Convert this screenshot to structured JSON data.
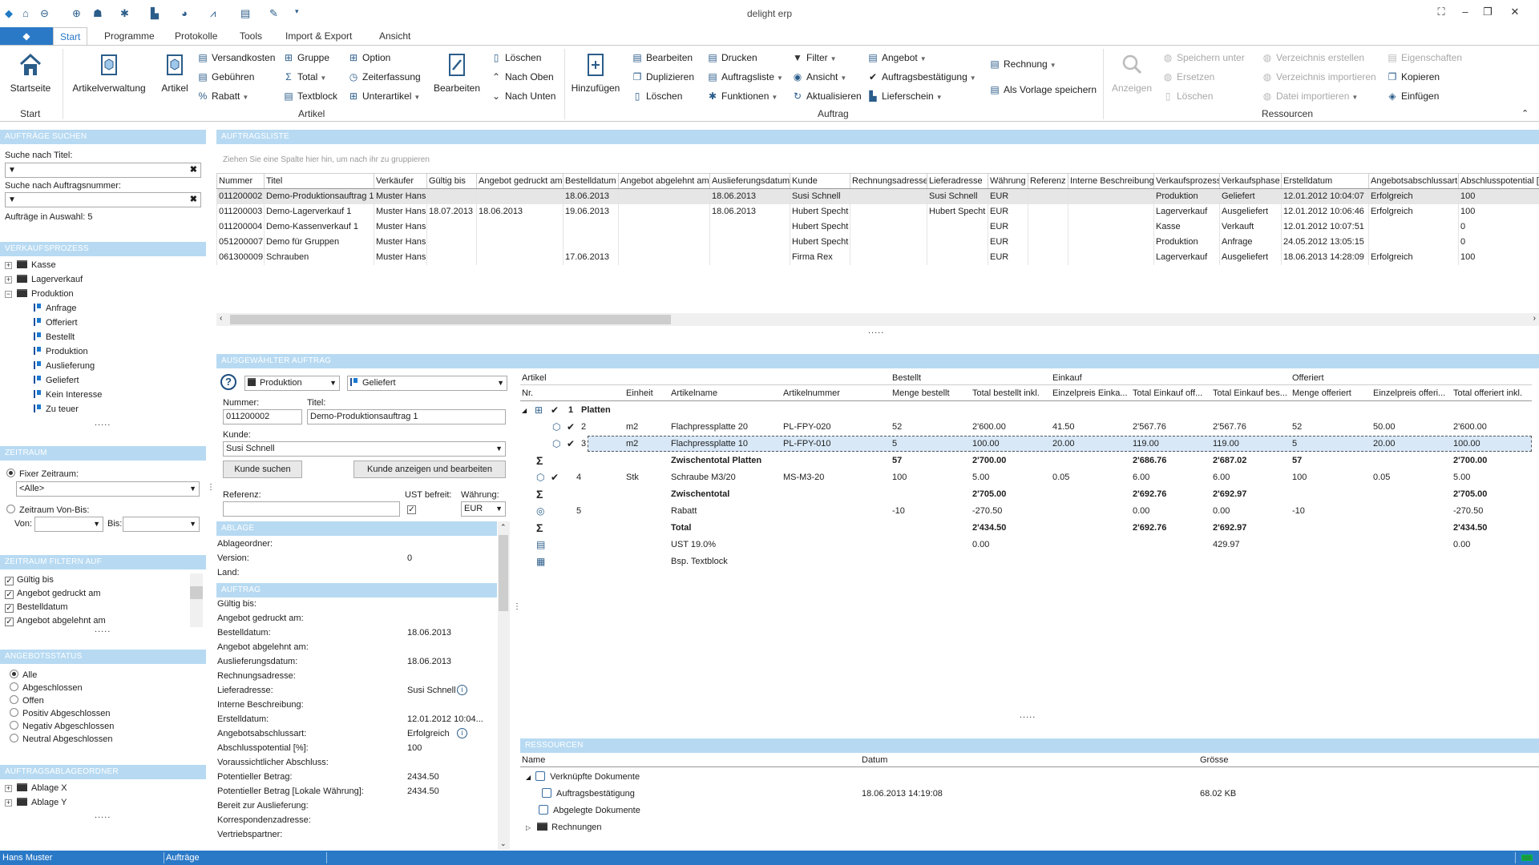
{
  "app": {
    "title": "delight erp"
  },
  "tabs": {
    "file": "◆",
    "items": [
      "Start",
      "Programme",
      "Protokolle",
      "Tools",
      "Import & Export",
      "Ansicht"
    ]
  },
  "ribbon": {
    "startseite": "Startseite",
    "artikelverwaltung": "Artikelverwaltung",
    "artikel": "Artikel",
    "versandkosten": "Versandkosten",
    "gebuehren": "Gebühren",
    "rabatt": "Rabatt",
    "gruppe": "Gruppe",
    "total": "Total",
    "textblock": "Textblock",
    "option": "Option",
    "zeiterfassung": "Zeiterfassung",
    "unterartikel": "Unterartikel",
    "bearbeiten": "Bearbeiten",
    "loeschen": "Löschen",
    "nach_oben": "Nach Oben",
    "nach_unten": "Nach Unten",
    "hinzufuegen": "Hinzufügen",
    "bearbeiten2": "Bearbeiten",
    "duplizieren": "Duplizieren",
    "loeschen2": "Löschen",
    "drucken": "Drucken",
    "auftragsliste": "Auftragsliste",
    "funktionen": "Funktionen",
    "filter": "Filter",
    "ansicht": "Ansicht",
    "aktualisieren": "Aktualisieren",
    "angebot": "Angebot",
    "auftragsbestaetigung": "Auftragsbestätigung",
    "lieferschein": "Lieferschein",
    "rechnung": "Rechnung",
    "als_vorlage": "Als Vorlage speichern",
    "anzeigen": "Anzeigen",
    "speichern_unter": "Speichern unter",
    "ersetzen": "Ersetzen",
    "loeschen3": "Löschen",
    "verz_erstellen": "Verzeichnis erstellen",
    "verz_importieren": "Verzeichnis importieren",
    "datei_importieren": "Datei importieren",
    "eigenschaften": "Eigenschaften",
    "kopieren": "Kopieren",
    "einfuegen": "Einfügen",
    "groups": {
      "start": "Start",
      "artikel": "Artikel",
      "auftrag": "Auftrag",
      "ressourcen": "Ressourcen"
    }
  },
  "left": {
    "search_header": "AUFTRÄGE SUCHEN",
    "title_label": "Suche nach Titel:",
    "number_label": "Suche nach Auftragsnummer:",
    "count_text": "Aufträge in Auswahl:  5",
    "process_header": "VERKAUFSPROZESS",
    "process_items": [
      "Kasse",
      "Lagerverkauf",
      "Produktion"
    ],
    "phases": [
      "Anfrage",
      "Offeriert",
      "Bestellt",
      "Produktion",
      "Auslieferung",
      "Geliefert",
      "Kein Interesse",
      "Zu teuer"
    ],
    "zeitraum_header": "ZEITRAUM",
    "fixer": "Fixer Zeitraum:",
    "alle_sel": "<Alle>",
    "vonbis": "Zeitraum Von-Bis:",
    "von": "Von:",
    "bis": "Bis:",
    "filter_header": "ZEITRAUM FILTERN AUF",
    "filter_items": [
      "Gültig bis",
      "Angebot gedruckt am",
      "Bestelldatum",
      "Angebot abgelehnt am"
    ],
    "status_header": "ANGEBOTSSTATUS",
    "status_items": [
      "Alle",
      "Abgeschlossen",
      "Offen",
      "Positiv Abgeschlossen",
      "Negativ Abgeschlossen",
      "Neutral Abgeschlossen"
    ],
    "ablage_header": "AUFTRAGSABLAGEORDNER",
    "ablage_items": [
      "Ablage X",
      "Ablage Y"
    ],
    "more": "....."
  },
  "orders": {
    "header": "AUFTRAGSLISTE",
    "group_hint": "Ziehen Sie eine Spalte hier hin, um nach ihr zu gruppieren",
    "columns": [
      "Nummer",
      "Titel",
      "Verkäufer",
      "Gültig bis",
      "Angebot gedruckt am",
      "Bestelldatum",
      "Angebot abgelehnt am",
      "Auslieferungsdatum",
      "Kunde",
      "Rechnungsadresse",
      "Lieferadresse",
      "Währung",
      "Referenz",
      "Interne Beschreibung",
      "Verkaufsprozess",
      "Verkaufsphase",
      "Erstelldatum",
      "Angebotsabschlussart",
      "Abschlusspotential [%]"
    ],
    "rows": [
      [
        "011200002",
        "Demo-Produktionsauftrag 1",
        "Muster Hans",
        "",
        "",
        "18.06.2013",
        "",
        "18.06.2013",
        "Susi Schnell",
        "",
        "Susi Schnell",
        "EUR",
        "",
        "",
        "Produktion",
        "Geliefert",
        "12.01.2012 10:04:07",
        "Erfolgreich",
        "100"
      ],
      [
        "011200003",
        "Demo-Lagerverkauf 1",
        "Muster Hans",
        "18.07.2013",
        "18.06.2013",
        "19.06.2013",
        "",
        "18.06.2013",
        "Hubert Specht",
        "",
        "Hubert Specht",
        "EUR",
        "",
        "",
        "Lagerverkauf",
        "Ausgeliefert",
        "12.01.2012 10:06:46",
        "Erfolgreich",
        "100"
      ],
      [
        "011200004",
        "Demo-Kassenverkauf 1",
        "Muster Hans",
        "",
        "",
        "",
        "",
        "",
        "Hubert Specht",
        "",
        "",
        "EUR",
        "",
        "",
        "Kasse",
        "Verkauft",
        "12.01.2012 10:07:51",
        "",
        "0"
      ],
      [
        "051200007",
        "Demo für Gruppen",
        "Muster Hans",
        "",
        "",
        "",
        "",
        "",
        "Hubert Specht",
        "",
        "",
        "EUR",
        "",
        "",
        "Produktion",
        "Anfrage",
        "24.05.2012 13:05:15",
        "",
        "0"
      ],
      [
        "061300009",
        "Schrauben",
        "Muster Hans",
        "",
        "",
        "17.06.2013",
        "",
        "",
        "Firma Rex",
        "",
        "",
        "EUR",
        "",
        "",
        "Lagerverkauf",
        "Ausgeliefert",
        "18.06.2013 14:28:09",
        "Erfolgreich",
        "100"
      ]
    ],
    "splitter": "....."
  },
  "detail": {
    "header": "AUSGEWÄHLTER AUFTRAG",
    "prozess": "Produktion",
    "phase": "Geliefert",
    "nummer_label": "Nummer:",
    "nummer": "011200002",
    "titel_label": "Titel:",
    "titel": "Demo-Produktionsauftrag 1",
    "kunde_label": "Kunde:",
    "kunde": "Susi Schnell",
    "kunde_suchen": "Kunde suchen",
    "kunde_anzeigen": "Kunde anzeigen und bearbeiten",
    "referenz_label": "Referenz:",
    "ust_label": "UST befreit:",
    "waehrung_label": "Währung:",
    "waehrung": "EUR",
    "ablage_header": "ABLAGE",
    "ablageordner": "Ablageordner:",
    "version": "Version:",
    "version_val": "0",
    "land": "Land:",
    "auftrag_header": "AUFTRAG",
    "props": [
      [
        "Gültig bis:",
        ""
      ],
      [
        "Angebot gedruckt am:",
        ""
      ],
      [
        "Bestelldatum:",
        "18.06.2013"
      ],
      [
        "Angebot abgelehnt am:",
        ""
      ],
      [
        "Auslieferungsdatum:",
        "18.06.2013"
      ],
      [
        "Rechnungsadresse:",
        ""
      ],
      [
        "Lieferadresse:",
        "Susi Schnell"
      ],
      [
        "Interne Beschreibung:",
        ""
      ],
      [
        "Erstelldatum:",
        "12.01.2012 10:04..."
      ],
      [
        "Angebotsabschlussart:",
        "Erfolgreich"
      ],
      [
        "Abschlusspotential [%]:",
        "100"
      ],
      [
        "Voraussichtlicher Abschluss:",
        ""
      ],
      [
        "Potentieller Betrag:",
        "2434.50"
      ],
      [
        "Potentieller Betrag [Lokale Währung]:",
        "2434.50"
      ],
      [
        "Bereit zur Auslieferung:",
        ""
      ],
      [
        "Korrespondenzadresse:",
        ""
      ],
      [
        "Vertriebspartner:",
        ""
      ]
    ]
  },
  "positions": {
    "group_headers": {
      "artikel": "Artikel",
      "bestellt": "Bestellt",
      "einkauf": "Einkauf",
      "offeriert": "Offeriert"
    },
    "columns": [
      "Nr.",
      "Einheit",
      "Artikelname",
      "Artikelnummer",
      "Menge bestellt",
      "Total bestellt inkl.",
      "Einzelpreis Einka...",
      "Total Einkauf off...",
      "Total Einkauf bes...",
      "Menge offeriert",
      "Einzelpreis offeri...",
      "Total offeriert inkl."
    ],
    "rows": [
      {
        "type": "group",
        "nr": "1",
        "einheit": "Platten",
        "name": "",
        "artnr": "",
        "mb": "",
        "tb": "",
        "ep": "",
        "teo": "",
        "teb": "",
        "mo": "",
        "epo": "",
        "to": ""
      },
      {
        "type": "item",
        "nr": "2",
        "einheit": "m2",
        "name": "Flachpressplatte 20",
        "artnr": "PL-FPY-020",
        "mb": "52",
        "tb": "2'600.00",
        "ep": "41.50",
        "teo": "2'567.76",
        "teb": "2'567.76",
        "mo": "52",
        "epo": "50.00",
        "to": "2'600.00"
      },
      {
        "type": "item",
        "nr": "3",
        "einheit": "m2",
        "name": "Flachpressplatte 10",
        "artnr": "PL-FPY-010",
        "mb": "5",
        "tb": "100.00",
        "ep": "20.00",
        "teo": "119.00",
        "teb": "119.00",
        "mo": "5",
        "epo": "20.00",
        "to": "100.00"
      },
      {
        "type": "sum",
        "nr": "",
        "einheit": "",
        "name": "Zwischentotal Platten",
        "artnr": "",
        "mb": "57",
        "tb": "2'700.00",
        "ep": "",
        "teo": "2'686.76",
        "teb": "2'687.02",
        "mo": "57",
        "epo": "",
        "to": "2'700.00"
      },
      {
        "type": "item",
        "nr": "4",
        "einheit": "Stk",
        "name": "Schraube M3/20",
        "artnr": "MS-M3-20",
        "mb": "100",
        "tb": "5.00",
        "ep": "0.05",
        "teo": "6.00",
        "teb": "6.00",
        "mo": "100",
        "epo": "0.05",
        "to": "5.00"
      },
      {
        "type": "sum",
        "nr": "",
        "einheit": "",
        "name": "Zwischentotal",
        "artnr": "",
        "mb": "",
        "tb": "2'705.00",
        "ep": "",
        "teo": "2'692.76",
        "teb": "2'692.97",
        "mo": "",
        "epo": "",
        "to": "2'705.00"
      },
      {
        "type": "item",
        "nr": "5",
        "einheit": "",
        "name": "Rabatt",
        "artnr": "",
        "mb": "-10",
        "tb": "-270.50",
        "ep": "",
        "teo": "0.00",
        "teb": "0.00",
        "mo": "-10",
        "epo": "",
        "to": "-270.50"
      },
      {
        "type": "sum",
        "nr": "",
        "einheit": "",
        "name": "Total",
        "artnr": "",
        "mb": "",
        "tb": "2'434.50",
        "ep": "",
        "teo": "2'692.76",
        "teb": "2'692.97",
        "mo": "",
        "epo": "",
        "to": "2'434.50"
      },
      {
        "type": "tax",
        "nr": "",
        "einheit": "",
        "name": "UST 19.0%",
        "artnr": "",
        "mb": "",
        "tb": "0.00",
        "ep": "",
        "teo": "",
        "teb": "429.97",
        "mo": "",
        "epo": "",
        "to": "0.00"
      },
      {
        "type": "text",
        "nr": "",
        "einheit": "",
        "name": "Bsp. Textblock",
        "artnr": "",
        "mb": "",
        "tb": "",
        "ep": "",
        "teo": "",
        "teb": "",
        "mo": "",
        "epo": "",
        "to": ""
      }
    ]
  },
  "resources": {
    "header": "RESSOURCEN",
    "cols": [
      "Name",
      "Datum",
      "Grösse"
    ],
    "items": [
      [
        "Verknüpfte Dokumente",
        "",
        ""
      ],
      [
        "Auftragsbestätigung",
        "18.06.2013 14:19:08",
        "68.02 KB"
      ],
      [
        "Abgelegte Dokumente",
        "",
        ""
      ],
      [
        "Rechnungen",
        "",
        ""
      ]
    ]
  },
  "status": {
    "user": "Hans Muster",
    "module": "Aufträge"
  }
}
